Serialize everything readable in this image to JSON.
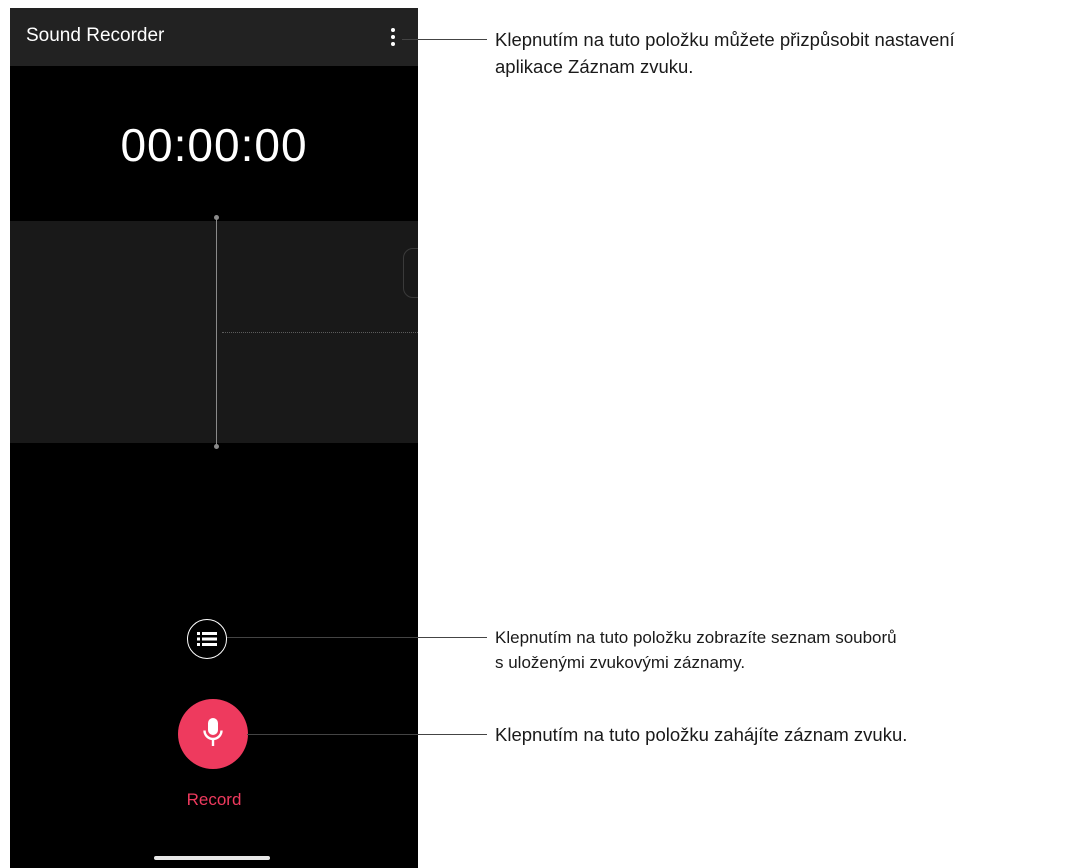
{
  "app": {
    "title": "Sound Recorder",
    "timer": "00:00:00",
    "record_label": "Record"
  },
  "icons": {
    "menu": "more-vertical-icon",
    "list": "list-icon",
    "record": "microphone-icon"
  },
  "colors": {
    "accent": "#ee3a5e",
    "app_bar": "#222222",
    "background": "#000000",
    "waveform_area": "#191919"
  },
  "callouts": {
    "menu": {
      "line1": "Klepnutím na tuto položku můžete přizpůsobit nastavení",
      "line2": "aplikace Záznam zvuku."
    },
    "list": {
      "line1": "Klepnutím na tuto položku zobrazíte seznam souborů",
      "line2": "s uloženými zvukovými záznamy."
    },
    "record": {
      "line1": "Klepnutím na tuto položku zahájíte záznam zvuku."
    }
  }
}
